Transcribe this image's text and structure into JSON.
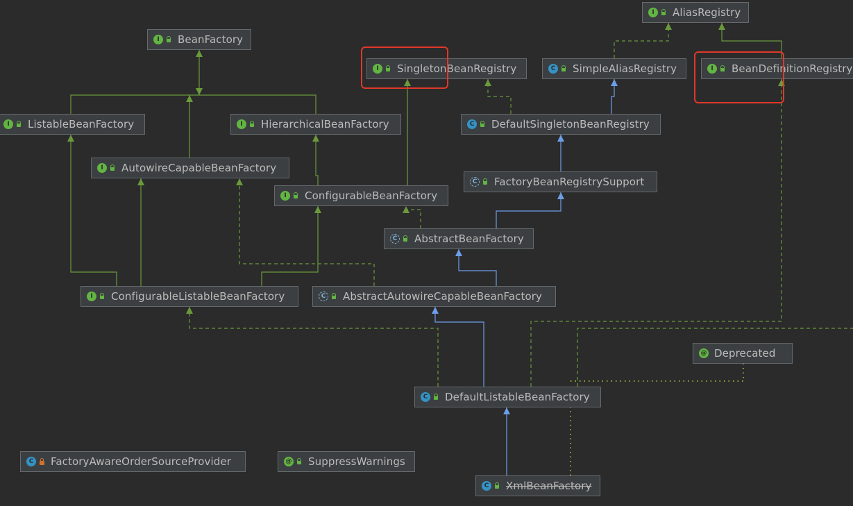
{
  "nodes": [
    {
      "id": "alias-registry",
      "label": "AliasRegistry",
      "kind": "interface",
      "visibility": "public"
    },
    {
      "id": "bean-factory",
      "label": "BeanFactory",
      "kind": "interface",
      "visibility": "public"
    },
    {
      "id": "singleton-bean-registry",
      "label": "SingletonBeanRegistry",
      "kind": "interface",
      "visibility": "public"
    },
    {
      "id": "simple-alias-registry",
      "label": "SimpleAliasRegistry",
      "kind": "class",
      "visibility": "public"
    },
    {
      "id": "bean-definition-registry",
      "label": "BeanDefinitionRegistry",
      "kind": "interface",
      "visibility": "public"
    },
    {
      "id": "listable-bean-factory",
      "label": "ListableBeanFactory",
      "kind": "interface",
      "visibility": "public"
    },
    {
      "id": "hierarchical-bean-factory",
      "label": "HierarchicalBeanFactory",
      "kind": "interface",
      "visibility": "public"
    },
    {
      "id": "default-singleton-bean-registry",
      "label": "DefaultSingletonBeanRegistry",
      "kind": "class",
      "visibility": "public"
    },
    {
      "id": "autowire-capable-bean-factory",
      "label": "AutowireCapableBeanFactory",
      "kind": "interface",
      "visibility": "public"
    },
    {
      "id": "factory-bean-registry-support",
      "label": "FactoryBeanRegistrySupport",
      "kind": "abstract",
      "visibility": "public"
    },
    {
      "id": "configurable-bean-factory",
      "label": "ConfigurableBeanFactory",
      "kind": "interface",
      "visibility": "public"
    },
    {
      "id": "abstract-bean-factory",
      "label": "AbstractBeanFactory",
      "kind": "abstract",
      "visibility": "public"
    },
    {
      "id": "configurable-listable-bean-factory",
      "label": "ConfigurableListableBeanFactory",
      "kind": "interface",
      "visibility": "public"
    },
    {
      "id": "abstract-autowire-capable-bean-factory",
      "label": "AbstractAutowireCapableBeanFactory",
      "kind": "abstract",
      "visibility": "public"
    },
    {
      "id": "deprecated",
      "label": "Deprecated",
      "kind": "annotation",
      "visibility": "none"
    },
    {
      "id": "default-listable-bean-factory",
      "label": "DefaultListableBeanFactory",
      "kind": "class",
      "visibility": "public"
    },
    {
      "id": "factory-aware-order-source-provider",
      "label": "FactoryAwareOrderSourceProvider",
      "kind": "class",
      "visibility": "private"
    },
    {
      "id": "suppress-warnings",
      "label": "SuppressWarnings",
      "kind": "annotation",
      "visibility": "public"
    },
    {
      "id": "xml-bean-factory",
      "label": "XmlBeanFactory",
      "kind": "class",
      "visibility": "public",
      "deprecated": true
    }
  ],
  "edges": [
    {
      "from": "listable-bean-factory",
      "to": "bean-factory",
      "type": "extends"
    },
    {
      "from": "hierarchical-bean-factory",
      "to": "bean-factory",
      "type": "extends"
    },
    {
      "from": "autowire-capable-bean-factory",
      "to": "bean-factory",
      "type": "extends"
    },
    {
      "from": "configurable-bean-factory",
      "to": "hierarchical-bean-factory",
      "type": "extends"
    },
    {
      "from": "configurable-bean-factory",
      "to": "singleton-bean-registry",
      "type": "extends"
    },
    {
      "from": "configurable-listable-bean-factory",
      "to": "listable-bean-factory",
      "type": "extends"
    },
    {
      "from": "configurable-listable-bean-factory",
      "to": "autowire-capable-bean-factory",
      "type": "extends"
    },
    {
      "from": "configurable-listable-bean-factory",
      "to": "configurable-bean-factory",
      "type": "extends"
    },
    {
      "from": "default-singleton-bean-registry",
      "to": "singleton-bean-registry",
      "type": "implements"
    },
    {
      "from": "default-singleton-bean-registry",
      "to": "simple-alias-registry",
      "type": "class-extends"
    },
    {
      "from": "simple-alias-registry",
      "to": "alias-registry",
      "type": "implements"
    },
    {
      "from": "bean-definition-registry",
      "to": "alias-registry",
      "type": "extends"
    },
    {
      "from": "factory-bean-registry-support",
      "to": "default-singleton-bean-registry",
      "type": "class-extends"
    },
    {
      "from": "abstract-bean-factory",
      "to": "factory-bean-registry-support",
      "type": "class-extends"
    },
    {
      "from": "abstract-bean-factory",
      "to": "configurable-bean-factory",
      "type": "implements"
    },
    {
      "from": "abstract-autowire-capable-bean-factory",
      "to": "abstract-bean-factory",
      "type": "class-extends"
    },
    {
      "from": "abstract-autowire-capable-bean-factory",
      "to": "autowire-capable-bean-factory",
      "type": "implements"
    },
    {
      "from": "default-listable-bean-factory",
      "to": "abstract-autowire-capable-bean-factory",
      "type": "class-extends"
    },
    {
      "from": "default-listable-bean-factory",
      "to": "configurable-listable-bean-factory",
      "type": "implements"
    },
    {
      "from": "default-listable-bean-factory",
      "to": "bean-definition-registry",
      "type": "implements"
    },
    {
      "from": "xml-bean-factory",
      "to": "default-listable-bean-factory",
      "type": "class-extends"
    },
    {
      "from": "default-listable-bean-factory",
      "to": "deprecated",
      "type": "annotated"
    },
    {
      "from": "xml-bean-factory",
      "to": "deprecated",
      "type": "annotated"
    }
  ],
  "highlighted": [
    "singleton-bean-registry",
    "bean-definition-registry"
  ],
  "colors": {
    "background": "#2b2b2b",
    "node_fill": "#3c3f41",
    "node_border": "#666a6d",
    "text": "#bbbbbb",
    "interface_edge": "#6a9a3c",
    "class_edge": "#6d9ee8",
    "annotation_edge": "#9aa83a",
    "highlight": "#e0382b",
    "interface_badge": "#62b543",
    "class_badge": "#3592c4",
    "private_lock": "#d0732f"
  },
  "icons": {
    "interface": "interface-icon",
    "class": "class-icon",
    "abstract": "abstract-class-icon",
    "annotation": "annotation-icon",
    "public": "public-visibility-icon",
    "private": "private-lock-icon"
  }
}
